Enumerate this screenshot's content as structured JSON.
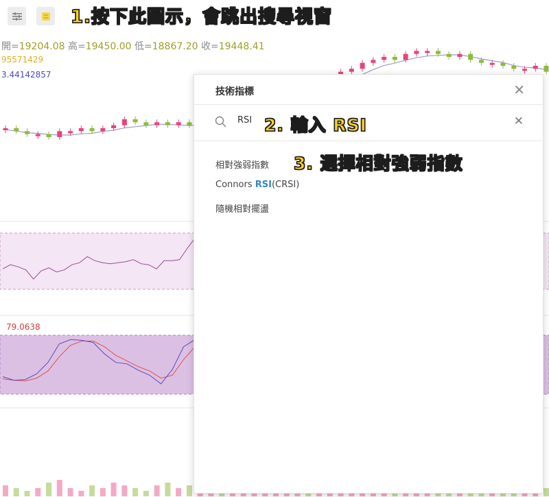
{
  "toolbar": {
    "settings_icon": "sliders-icon",
    "indicator_icon": "indicator-icon",
    "indicator_color": "#f5d84a"
  },
  "ohlc": {
    "open_label": "開=",
    "open": "19204.08",
    "high_label": "高=",
    "high": "19450.00",
    "low_label": "低=",
    "low": "18867.20",
    "close_label": "收=",
    "close": "19448.41"
  },
  "ma_values": [
    "95571429",
    "3.44142857"
  ],
  "kd_value": "79.0638",
  "annotations": {
    "step1": "1.按下此圖示，會跳出搜尋視窗",
    "step2": "2. 輸入 RSI",
    "step3": "3. 選擇相對強弱指數"
  },
  "dialog": {
    "title": "技術指標",
    "search_value": "RSI",
    "results": [
      {
        "pre": "相對強弱指數",
        "hl": "",
        "post": ""
      },
      {
        "pre": "Connors ",
        "hl": "RSI",
        "post": "(CRSI)"
      },
      {
        "pre": "隨機相對擺盪",
        "hl": "",
        "post": ""
      }
    ]
  },
  "colors": {
    "up": "#e8437a",
    "down": "#8dbb3c",
    "rsi_band": "#f4e6f4",
    "kd_band": "#dcc0e4",
    "highlight": "#2f89c8"
  },
  "chart_data": {
    "type": "candlestick",
    "close_series": [
      18,
      17,
      16,
      16,
      15,
      17,
      17,
      18,
      17,
      18,
      19,
      21,
      20,
      19,
      20,
      19,
      20,
      19,
      20,
      21,
      19,
      20,
      21,
      22,
      24,
      26,
      30,
      32,
      31,
      33,
      35,
      37,
      38,
      40,
      41,
      42,
      41,
      43,
      44,
      44,
      43,
      42,
      43,
      41,
      40,
      40,
      39,
      38,
      38,
      39,
      37
    ],
    "rsi_series": [
      40,
      44,
      42,
      39,
      30,
      38,
      41,
      37,
      39,
      44,
      46,
      52,
      48,
      46,
      45,
      46,
      47,
      49,
      45,
      44,
      40,
      48,
      48,
      49,
      60,
      70
    ],
    "k_series": [
      38,
      33,
      34,
      42,
      58,
      84,
      90,
      89,
      86,
      70,
      58,
      56,
      47,
      40,
      28,
      48,
      80,
      90
    ],
    "d_series": [
      35,
      33,
      32,
      36,
      46,
      66,
      82,
      88,
      88,
      80,
      68,
      60,
      52,
      46,
      36,
      40,
      62,
      80
    ],
    "volume": [
      4,
      3,
      2,
      3,
      5,
      6,
      3,
      2,
      4,
      3,
      5,
      4,
      3,
      2,
      4,
      5,
      3,
      4,
      6,
      5,
      3,
      4,
      5,
      4,
      6,
      5,
      4,
      3,
      5,
      4,
      6,
      5,
      4,
      3,
      4,
      5,
      6,
      4,
      5,
      3,
      4,
      5,
      6,
      4,
      3,
      5,
      4,
      3,
      5,
      4,
      3
    ]
  }
}
